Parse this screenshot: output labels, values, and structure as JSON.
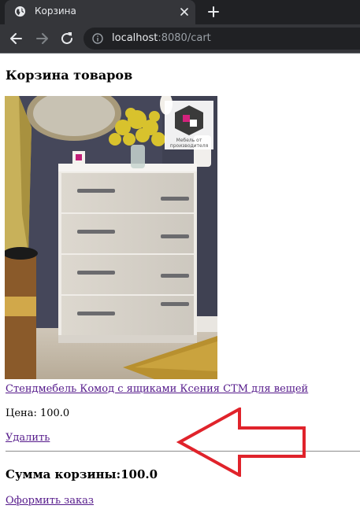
{
  "browser": {
    "tab_title": "Корзина",
    "url_host": "localhost",
    "url_rest": ":8080/cart",
    "icons": [
      "globe-icon",
      "close-icon",
      "plus-icon",
      "back-arrow-icon",
      "forward-arrow-icon",
      "reload-icon",
      "info-icon"
    ]
  },
  "page": {
    "heading": "Корзина товаров",
    "item": {
      "title": "Стендмебель Комод с ящиками Ксения СТМ для вещей",
      "price_text": "Цена: 100.0",
      "delete_label": "Удалить",
      "image": {
        "subject": "light wooden chest of drawers with yellow flowers in a vase",
        "logo_lines": [
          "Мебель от",
          "производителя"
        ]
      }
    },
    "total_text": "Сумма корзины:100.0",
    "checkout_label": "Оформить заказ"
  },
  "annotation": {
    "shape": "red-outline-arrow",
    "color": "#e0232b",
    "points_to": "delete-link"
  },
  "colors": {
    "link": "#551a8b",
    "chrome_dark": "#202124",
    "chrome_tab": "#35363a",
    "divider": "#8c8c8c"
  }
}
